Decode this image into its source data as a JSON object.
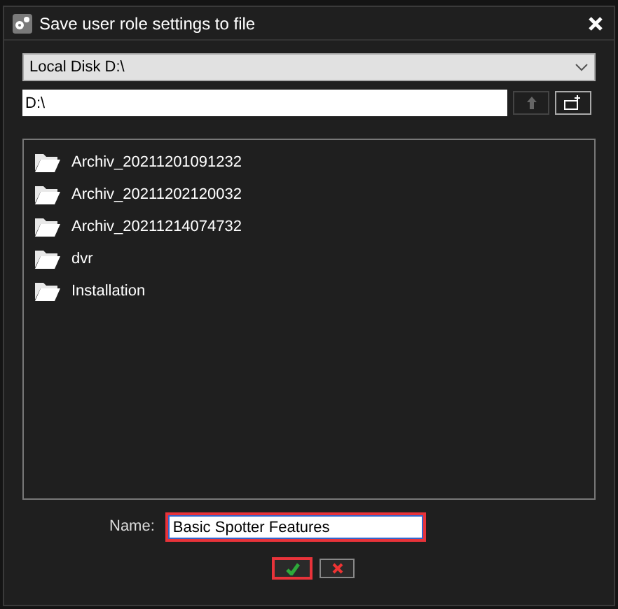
{
  "window": {
    "title": "Save user role settings to file"
  },
  "drive_select": {
    "value": "Local Disk D:\\"
  },
  "path_field": {
    "value": "D:\\"
  },
  "up_button": {
    "disabled": true
  },
  "files": [
    {
      "name": "Archiv_20211201091232"
    },
    {
      "name": "Archiv_20211202120032"
    },
    {
      "name": "Archiv_20211214074732"
    },
    {
      "name": "dvr"
    },
    {
      "name": "Installation"
    }
  ],
  "name_field": {
    "label": "Name:",
    "value": "Basic Spotter Features",
    "highlighted": true
  },
  "ok_button": {
    "highlighted": true
  }
}
